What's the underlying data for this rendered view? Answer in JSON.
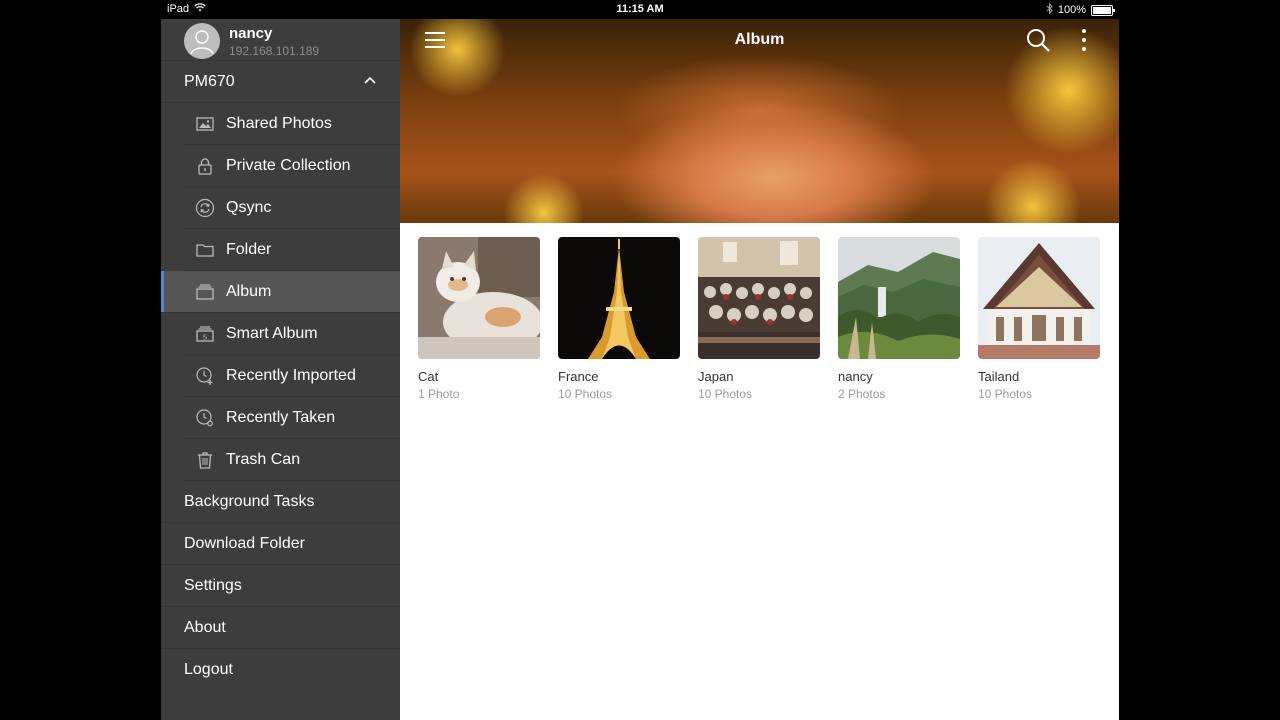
{
  "status_bar": {
    "device": "iPad",
    "time": "11:15 AM",
    "battery": "100%"
  },
  "profile": {
    "name": "nancy",
    "ip": "192.168.101.189"
  },
  "sidebar": {
    "server": "PM670",
    "sub_items": [
      {
        "label": "Shared Photos",
        "icon": "image-icon"
      },
      {
        "label": "Private Collection",
        "icon": "lock-icon"
      },
      {
        "label": "Qsync",
        "icon": "sync-icon"
      },
      {
        "label": "Folder",
        "icon": "folder-icon"
      },
      {
        "label": "Album",
        "icon": "album-icon",
        "active": true
      },
      {
        "label": "Smart Album",
        "icon": "smart-album-icon"
      },
      {
        "label": "Recently Imported",
        "icon": "clock-import-icon"
      },
      {
        "label": "Recently Taken",
        "icon": "clock-camera-icon"
      },
      {
        "label": "Trash Can",
        "icon": "trash-icon"
      }
    ],
    "items": [
      {
        "label": "Background Tasks"
      },
      {
        "label": "Download Folder"
      },
      {
        "label": "Settings"
      },
      {
        "label": "About"
      },
      {
        "label": "Logout"
      }
    ]
  },
  "header": {
    "title": "Album"
  },
  "albums": [
    {
      "name": "Cat",
      "count": "1 Photo"
    },
    {
      "name": "France",
      "count": "10 Photos"
    },
    {
      "name": "Japan",
      "count": "10 Photos"
    },
    {
      "name": "nancy",
      "count": "2 Photos"
    },
    {
      "name": "Tailand",
      "count": "10 Photos"
    }
  ],
  "colors": {
    "sidebar_bg": "#3d3d3d",
    "active_bg": "#555555",
    "accent": "#3f8fd6"
  }
}
